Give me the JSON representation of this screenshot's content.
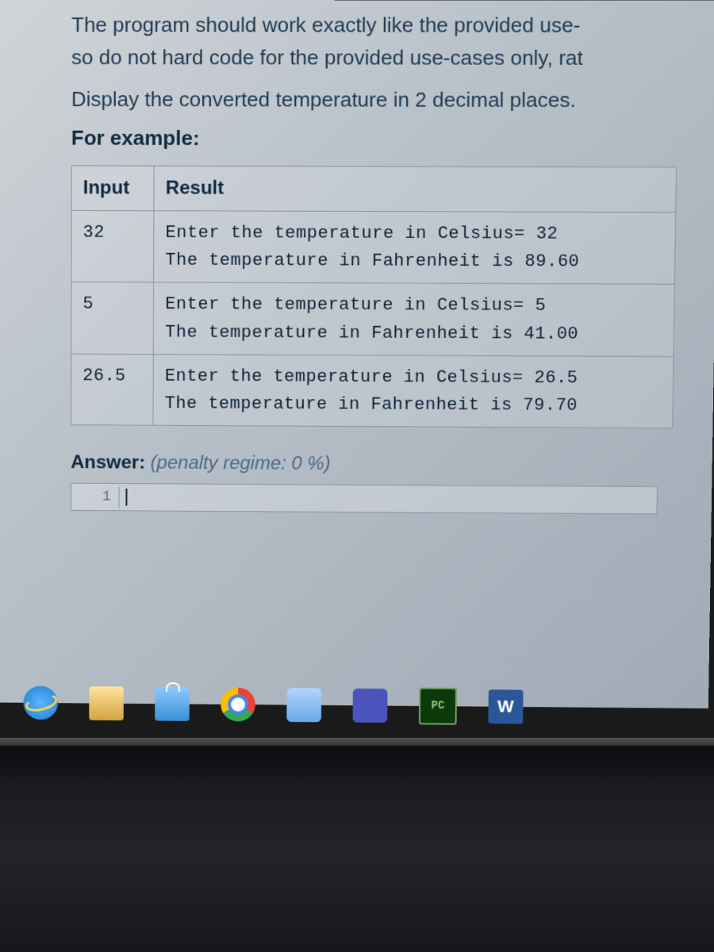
{
  "text": {
    "line1": "The program should work exactly like the provided use-",
    "line2": "so do not hard code for the provided use-cases only, rat",
    "line3": "Display the converted temperature in 2 decimal places.",
    "example_heading": "For example:",
    "answer_label": "Answer:",
    "penalty": "(penalty regime: 0 %)",
    "line_number": "1"
  },
  "table": {
    "headers": {
      "col1": "Input",
      "col2": "Result"
    },
    "rows": [
      {
        "input": "32",
        "result": "Enter the temperature in Celsius= 32\nThe temperature in Fahrenheit is 89.60"
      },
      {
        "input": "5",
        "result": "Enter the temperature in Celsius= 5\nThe temperature in Fahrenheit is 41.00"
      },
      {
        "input": "26.5",
        "result": "Enter the temperature in Celsius= 26.5\nThe temperature in Fahrenheit is 79.70"
      }
    ]
  },
  "taskbar": {
    "ie": "e",
    "store": "",
    "teams": "",
    "pc": "PC",
    "word": "W"
  }
}
